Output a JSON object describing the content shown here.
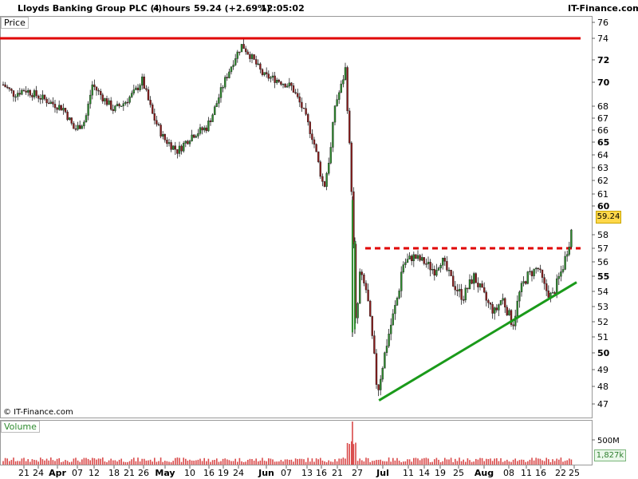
{
  "header": {
    "title": "Lloyds Banking Group PLC (-)",
    "timeframe": "4 hours",
    "last_change": "59.24 (+2.69%)",
    "time": "12:05:02",
    "brand": "IT-Finance.com"
  },
  "copyright": "© IT-Finance.com",
  "colors": {
    "up_candle": "#2e8b2e",
    "down_candle": "#8b1c1c",
    "resistance_line": "#e00000",
    "support_trendline": "#1a9a1a",
    "price_tag_bg": "#ffd84a",
    "volume_bar": "#d94a4a"
  },
  "chart_data": {
    "type": "candlestick",
    "panels": {
      "price_label": "Price",
      "volume_label": "Volume"
    },
    "last_price_tag": "59.24",
    "volume_tag": "1,827k",
    "price_axis_ticks": [
      "76",
      "74",
      "72",
      "70",
      "68",
      "67",
      "66",
      "65",
      "64",
      "63",
      "62",
      "61",
      "60",
      "59.24",
      "58",
      "57",
      "56",
      "55",
      "54",
      "53",
      "52",
      "51",
      "50",
      "49",
      "48",
      "47"
    ],
    "price_axis_values": [
      76,
      74,
      72,
      70,
      68,
      67,
      66,
      65,
      64,
      63,
      62,
      61,
      60,
      58,
      57,
      56,
      55,
      54,
      53,
      52,
      51,
      50,
      49,
      48,
      47
    ],
    "bold_ticks": [
      72,
      70,
      65,
      60,
      55,
      50
    ],
    "volume_axis_ticks": [
      "500M"
    ],
    "x_tick_labels": [
      "21",
      "24",
      "Apr",
      "07",
      "12",
      "18",
      "21",
      "26",
      "May",
      "10",
      "16",
      "19",
      "24",
      "Jun",
      "07",
      "13",
      "16",
      "21",
      "27",
      "Jul",
      "11",
      "14",
      "19",
      "25",
      "Aug",
      "08",
      "11",
      "16",
      "22",
      "25"
    ],
    "bold_x_labels": [
      "Apr",
      "May",
      "Jun",
      "Jul",
      "Aug"
    ],
    "levels": [
      {
        "name": "horizontal resistance",
        "price": 74.0
      },
      {
        "name": "dashed neckline resistance",
        "price": 57.0
      }
    ],
    "trendline": {
      "from": {
        "date": "Jul 01",
        "price": 47.2
      },
      "to": {
        "date": "Aug 25",
        "price": 54.6
      }
    },
    "price_path": [
      {
        "date": "Mar 18",
        "price": 69.8
      },
      {
        "date": "Mar 21",
        "price": 69.0
      },
      {
        "date": "Mar 24",
        "price": 69.4
      },
      {
        "date": "Mar 28",
        "price": 68.8
      },
      {
        "date": "Apr 01",
        "price": 68.2
      },
      {
        "date": "Apr 04",
        "price": 67.8
      },
      {
        "date": "Apr 07",
        "price": 66.0
      },
      {
        "date": "Apr 10",
        "price": 66.8
      },
      {
        "date": "Apr 12",
        "price": 69.8
      },
      {
        "date": "Apr 15",
        "price": 68.7
      },
      {
        "date": "Apr 18",
        "price": 67.7
      },
      {
        "date": "Apr 21",
        "price": 68.3
      },
      {
        "date": "Apr 24",
        "price": 69.2
      },
      {
        "date": "Apr 26",
        "price": 70.2
      },
      {
        "date": "Apr 29",
        "price": 67.2
      },
      {
        "date": "May 02",
        "price": 65.3
      },
      {
        "date": "May 06",
        "price": 64.3
      },
      {
        "date": "May 10",
        "price": 65.6
      },
      {
        "date": "May 14",
        "price": 66.2
      },
      {
        "date": "May 16",
        "price": 67.5
      },
      {
        "date": "May 19",
        "price": 70.0
      },
      {
        "date": "May 22",
        "price": 72.2
      },
      {
        "date": "May 24",
        "price": 73.4
      },
      {
        "date": "May 27",
        "price": 72.1
      },
      {
        "date": "May 30",
        "price": 70.6
      },
      {
        "date": "Jun 03",
        "price": 70.2
      },
      {
        "date": "Jun 07",
        "price": 69.6
      },
      {
        "date": "Jun 10",
        "price": 67.8
      },
      {
        "date": "Jun 13",
        "price": 65.2
      },
      {
        "date": "Jun 15",
        "price": 62.6
      },
      {
        "date": "Jun 16",
        "price": 61.4
      },
      {
        "date": "Jun 18",
        "price": 64.6
      },
      {
        "date": "Jun 19",
        "price": 68.0
      },
      {
        "date": "Jun 21",
        "price": 69.8
      },
      {
        "date": "Jun 22",
        "price": 71.2
      },
      {
        "date": "Jun 24",
        "price": 60.0
      },
      {
        "date": "Jun 25",
        "price": 51.2
      },
      {
        "date": "Jun 26",
        "price": 55.2
      },
      {
        "date": "Jun 28",
        "price": 54.0
      },
      {
        "date": "Jun 30",
        "price": 50.0
      },
      {
        "date": "Jul 01",
        "price": 47.6
      },
      {
        "date": "Jul 04",
        "price": 51.0
      },
      {
        "date": "Jul 07",
        "price": 54.0
      },
      {
        "date": "Jul 08",
        "price": 55.8
      },
      {
        "date": "Jul 11",
        "price": 56.4
      },
      {
        "date": "Jul 14",
        "price": 56.0
      },
      {
        "date": "Jul 17",
        "price": 55.4
      },
      {
        "date": "Jul 19",
        "price": 56.2
      },
      {
        "date": "Jul 22",
        "price": 54.6
      },
      {
        "date": "Jul 25",
        "price": 53.6
      },
      {
        "date": "Jul 28",
        "price": 55.0
      },
      {
        "date": "Aug 01",
        "price": 53.2
      },
      {
        "date": "Aug 03",
        "price": 52.6
      },
      {
        "date": "Aug 05",
        "price": 53.6
      },
      {
        "date": "Aug 08",
        "price": 51.8
      },
      {
        "date": "Aug 10",
        "price": 54.0
      },
      {
        "date": "Aug 12",
        "price": 55.0
      },
      {
        "date": "Aug 15",
        "price": 55.6
      },
      {
        "date": "Aug 17",
        "price": 54.2
      },
      {
        "date": "Aug 19",
        "price": 53.6
      },
      {
        "date": "Aug 22",
        "price": 55.6
      },
      {
        "date": "Aug 24",
        "price": 57.6
      },
      {
        "date": "Aug 25",
        "price": 59.2
      }
    ]
  }
}
